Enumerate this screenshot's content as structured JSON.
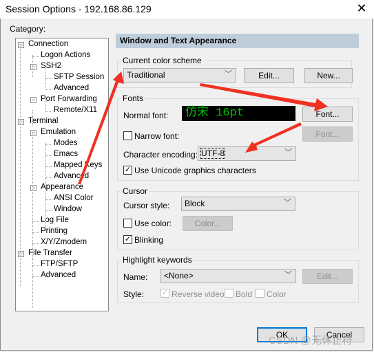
{
  "window": {
    "title": "Session Options - 192.168.86.129",
    "close_icon": "close-icon"
  },
  "category_label": "Category:",
  "tree": [
    {
      "label": "Connection",
      "level": 0,
      "expander": "−"
    },
    {
      "label": "Logon Actions",
      "level": 1
    },
    {
      "label": "SSH2",
      "level": 1,
      "expander": "−"
    },
    {
      "label": "SFTP Session",
      "level": 2
    },
    {
      "label": "Advanced",
      "level": 2
    },
    {
      "label": "Port Forwarding",
      "level": 1,
      "expander": "−"
    },
    {
      "label": "Remote/X11",
      "level": 2
    },
    {
      "label": "Terminal",
      "level": 0,
      "expander": "−"
    },
    {
      "label": "Emulation",
      "level": 1,
      "expander": "−"
    },
    {
      "label": "Modes",
      "level": 2
    },
    {
      "label": "Emacs",
      "level": 2
    },
    {
      "label": "Mapped Keys",
      "level": 2
    },
    {
      "label": "Advanced",
      "level": 2
    },
    {
      "label": "Appearance",
      "level": 1,
      "expander": "−",
      "selected": true
    },
    {
      "label": "ANSI Color",
      "level": 2
    },
    {
      "label": "Window",
      "level": 2
    },
    {
      "label": "Log File",
      "level": 1
    },
    {
      "label": "Printing",
      "level": 1
    },
    {
      "label": "X/Y/Zmodem",
      "level": 1
    },
    {
      "label": "File Transfer",
      "level": 0,
      "expander": "−"
    },
    {
      "label": "FTP/SFTP",
      "level": 1
    },
    {
      "label": "Advanced",
      "level": 1
    }
  ],
  "panel": {
    "header": "Window and Text Appearance",
    "color_scheme": {
      "legend": "Current color scheme",
      "value": "Traditional",
      "edit": "Edit...",
      "new": "New..."
    },
    "fonts": {
      "legend": "Fonts",
      "normal_label": "Normal font:",
      "normal_preview": "仿宋 16pt",
      "font_button": "Font...",
      "narrow_label": "Narrow font:",
      "narrow_checked": false,
      "narrow_button": "Font...",
      "encoding_label": "Character encoding:",
      "encoding_value": "UTF-8",
      "unicode_label": "Use Unicode graphics characters",
      "unicode_checked": true
    },
    "cursor": {
      "legend": "Cursor",
      "style_label": "Cursor style:",
      "style_value": "Block",
      "use_color_label": "Use color:",
      "use_color_checked": false,
      "color_button": "Color...",
      "blinking_label": "Blinking",
      "blinking_checked": true
    },
    "highlight": {
      "legend": "Highlight keywords",
      "name_label": "Name:",
      "name_value": "<None>",
      "edit": "Edit...",
      "style_label": "Style:",
      "reverse_label": "Reverse video",
      "reverse_checked": true,
      "bold_label": "Bold",
      "bold_checked": false,
      "color_label": "Color",
      "color_checked": false
    }
  },
  "buttons": {
    "ok": "OK",
    "cancel": "Cancel"
  },
  "watermark": "CSDN @无休止符",
  "colors": {
    "header_bg": "#bfcddb",
    "preview_bg": "#000000",
    "preview_fg": "#00c000",
    "annotation_arrow": "#f03020",
    "ok_border": "#0078d7"
  }
}
